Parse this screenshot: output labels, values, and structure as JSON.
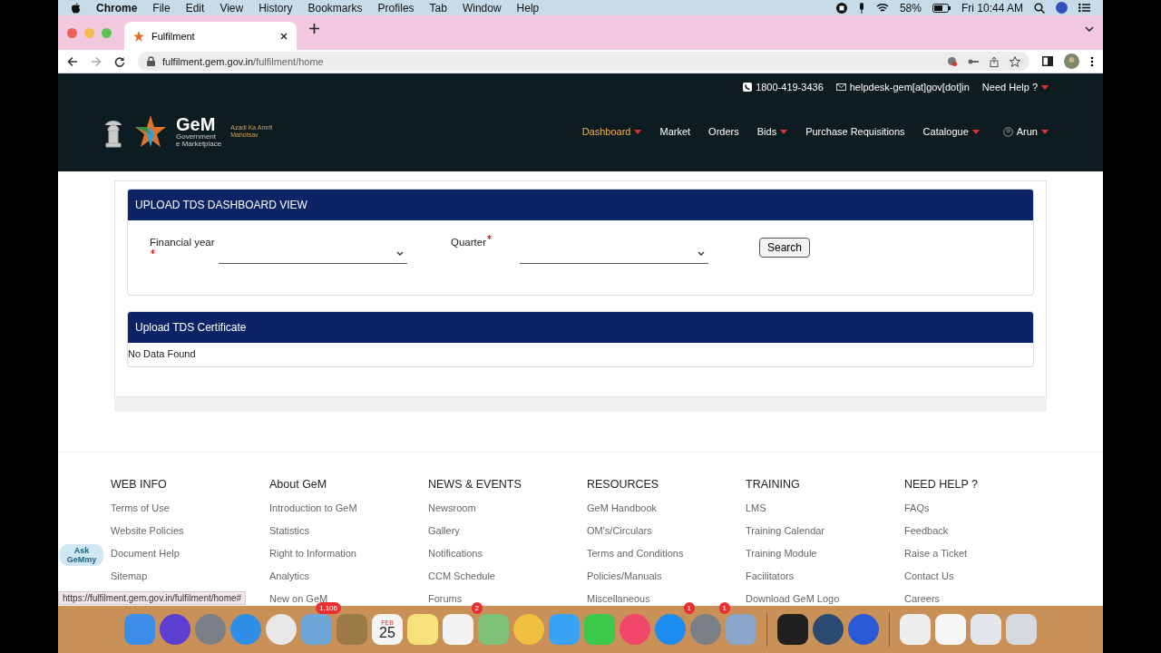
{
  "menu_bar": {
    "app": "Chrome",
    "items": [
      "File",
      "Edit",
      "View",
      "History",
      "Bookmarks",
      "Profiles",
      "Tab",
      "Window",
      "Help"
    ],
    "battery": "58%",
    "clock": "Fri 10:44 AM"
  },
  "browser": {
    "tab_title": "Fulfilment",
    "url_host": "fulfilment.gem.gov.in",
    "url_path": "/fulfilment/home"
  },
  "site_header": {
    "phone": "1800-419-3436",
    "email": "helpdesk-gem[at]gov[dot]in",
    "help": "Need Help ?",
    "logo": {
      "name": "GeM",
      "line1": "Government",
      "line2": "e Marketplace"
    },
    "azadi": "Azadi Ka Amrit Mahotsav",
    "nav": [
      {
        "label": "Dashboard",
        "dropdown": true,
        "selected": true
      },
      {
        "label": "Market",
        "dropdown": false,
        "selected": false
      },
      {
        "label": "Orders",
        "dropdown": false,
        "selected": false
      },
      {
        "label": "Bids",
        "dropdown": true,
        "selected": false
      },
      {
        "label": "Purchase Requisitions",
        "dropdown": false,
        "selected": false
      },
      {
        "label": "Catalogue",
        "dropdown": true,
        "selected": false
      }
    ],
    "user": "Arun"
  },
  "dashboard_panel": {
    "title": "UPLOAD TDS DASHBOARD VIEW",
    "fields": [
      {
        "label": "Financial year",
        "required": true
      },
      {
        "label": "Quarter",
        "required": true
      }
    ],
    "button": "Search"
  },
  "certificate_panel": {
    "title": "Upload TDS Certificate",
    "message": "No Data Found"
  },
  "footer": [
    {
      "title": "WEB INFO",
      "links": [
        "Terms of Use",
        "Website Policies",
        "Document Help",
        "Sitemap"
      ]
    },
    {
      "title": "About GeM",
      "links": [
        "Introduction to GeM",
        "Statistics",
        "Right to Information",
        "Analytics",
        "New on GeM"
      ]
    },
    {
      "title": "NEWS & EVENTS",
      "links": [
        "Newsroom",
        "Gallery",
        "Notifications",
        "CCM Schedule",
        "Forums"
      ]
    },
    {
      "title": "RESOURCES",
      "links": [
        "GeM Handbook",
        "OM's/Circulars",
        "Terms and Conditions",
        "Policies/Manuals",
        "Miscellaneous"
      ]
    },
    {
      "title": "TRAINING",
      "links": [
        "LMS",
        "Training Calendar",
        "Training Module",
        "Facilitators",
        "Download GeM Logo"
      ]
    },
    {
      "title": "NEED HELP ?",
      "links": [
        "FAQs",
        "Feedback",
        "Raise a Ticket",
        "Contact Us",
        "Careers"
      ]
    }
  ],
  "chatbot": "Ask GeMmy",
  "status_url": "https://fulfilment.gem.gov.in/fulfilment/home#",
  "dock": [
    {
      "kind": "finder",
      "color": "#3d8ee8"
    },
    {
      "kind": "siri",
      "color": "#5b3fd1"
    },
    {
      "kind": "launchpad",
      "color": "#7a7f88"
    },
    {
      "kind": "safari",
      "color": "#2f8fe8"
    },
    {
      "kind": "chrome",
      "color": "#e8e8e8"
    },
    {
      "kind": "mail",
      "color": "#6ea6d8",
      "badge": "1,106"
    },
    {
      "kind": "notes",
      "color": "#9c7a45"
    },
    {
      "kind": "calendar",
      "color": "#f4f4f4",
      "month": "FEB",
      "day": "25"
    },
    {
      "kind": "stickies",
      "color": "#f7e27a"
    },
    {
      "kind": "reminders",
      "color": "#f2f2f2",
      "badge": "2"
    },
    {
      "kind": "maps",
      "color": "#7fc27a"
    },
    {
      "kind": "photos",
      "color": "#f0c040"
    },
    {
      "kind": "messages",
      "color": "#3aa3f5"
    },
    {
      "kind": "facetime",
      "color": "#3cc84a"
    },
    {
      "kind": "music",
      "color": "#f0466a"
    },
    {
      "kind": "appstore",
      "color": "#1c8cf0",
      "badge": "1"
    },
    {
      "kind": "settings",
      "color": "#7b7f86",
      "badge": "1"
    },
    {
      "kind": "preview",
      "color": "#8aa6c8"
    },
    {
      "kind": "separator"
    },
    {
      "kind": "terminal",
      "color": "#202020"
    },
    {
      "kind": "quicktime",
      "color": "#2a4a70"
    },
    {
      "kind": "audio",
      "color": "#2a5ad8"
    },
    {
      "kind": "separator"
    },
    {
      "kind": "document",
      "color": "#eeeeee"
    },
    {
      "kind": "document",
      "color": "#f6f6f6"
    },
    {
      "kind": "document",
      "color": "#e4e8ee"
    },
    {
      "kind": "trash",
      "color": "#d6dade"
    }
  ]
}
